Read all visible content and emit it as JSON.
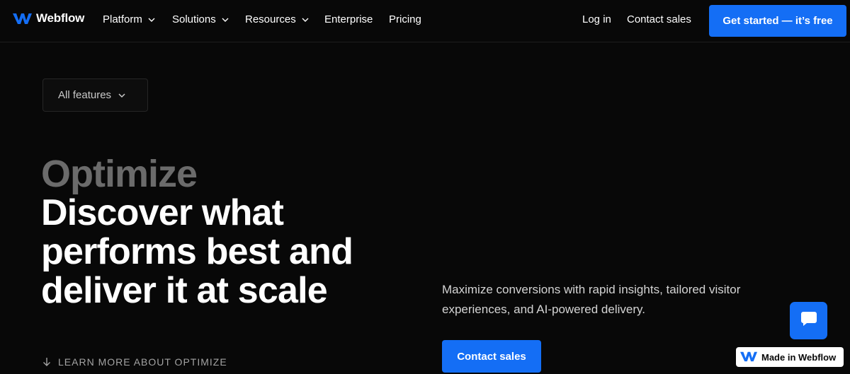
{
  "brand": {
    "name": "Webflow",
    "accent": "#146ef5",
    "icon": "webflow-logo-icon"
  },
  "nav": {
    "items": [
      {
        "label": "Platform",
        "has_dropdown": true
      },
      {
        "label": "Solutions",
        "has_dropdown": true
      },
      {
        "label": "Resources",
        "has_dropdown": true
      },
      {
        "label": "Enterprise",
        "has_dropdown": false
      },
      {
        "label": "Pricing",
        "has_dropdown": false
      }
    ],
    "login": "Log in",
    "contact": "Contact sales",
    "cta": "Get started — it’s free"
  },
  "features_dropdown": {
    "label": "All features",
    "icon": "chevron-down-icon"
  },
  "hero": {
    "eyebrow": "Optimize",
    "headline": "Discover what performs best and deliver it at scale",
    "learn_more": "LEARN MORE ABOUT OPTIMIZE",
    "learn_more_icon": "arrow-down-icon",
    "description": "Maximize conversions with rapid insights, tailored visitor experiences, and AI-powered delivery.",
    "cta": "Contact sales"
  },
  "chat": {
    "icon": "chat-bubble-icon"
  },
  "badge": {
    "label": "Made in Webflow",
    "icon": "webflow-logo-icon"
  }
}
